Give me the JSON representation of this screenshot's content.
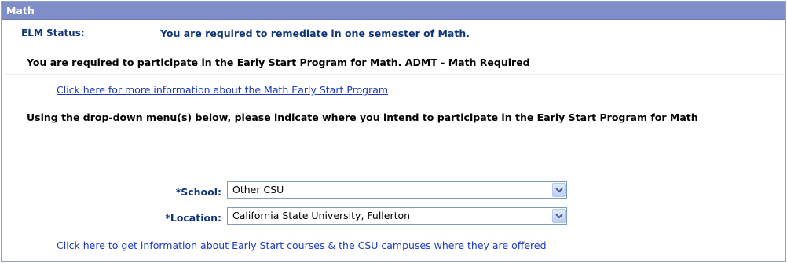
{
  "panel": {
    "title": "Math"
  },
  "elm": {
    "label": "ELM Status:",
    "value": "You are required to remediate in one semester of Math."
  },
  "required_message": "You are required to participate in the Early Start Program for Math. ADMT - Math Required",
  "links": {
    "more_info": "Click here for more information about the Math Early Start Program",
    "courses": "Click here to get information about Early Start courses & the CSU campuses where they are offered"
  },
  "instructions": "Using the drop-down menu(s) below, please indicate where you intend to participate in the Early Start Program for Math",
  "school": {
    "label": "*School:",
    "selected": "Other CSU"
  },
  "location": {
    "label": "*Location:",
    "selected": "California State University, Fullerton"
  },
  "icons": {
    "dropdown": "chevron-down-icon"
  },
  "colors": {
    "header_bg": "#7f8ec9",
    "label_text": "#10367a",
    "link": "#1d39c4"
  }
}
